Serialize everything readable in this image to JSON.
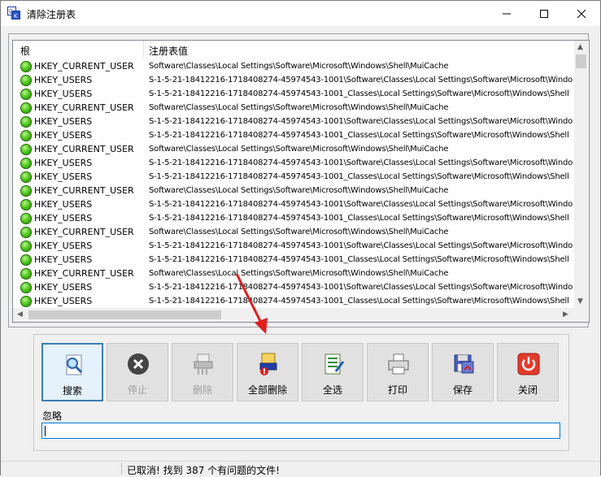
{
  "window": {
    "title": "清除注册表",
    "controls": {
      "minimize": "minimize-icon",
      "maximize": "maximize-icon",
      "close": "close-icon"
    }
  },
  "list": {
    "columns": [
      "根",
      "注册表值"
    ],
    "rows": [
      {
        "root": "HKEY_CURRENT_USER",
        "value": "Software\\Classes\\Local Settings\\Software\\Microsoft\\Windows\\Shell\\MuiCache"
      },
      {
        "root": "HKEY_USERS",
        "value": "S-1-5-21-18412216-1718408274-45974543-1001\\Software\\Classes\\Local Settings\\Software\\Microsoft\\Windo"
      },
      {
        "root": "HKEY_USERS",
        "value": "S-1-5-21-18412216-1718408274-45974543-1001_Classes\\Local Settings\\Software\\Microsoft\\Windows\\Shell"
      },
      {
        "root": "HKEY_CURRENT_USER",
        "value": "Software\\Classes\\Local Settings\\Software\\Microsoft\\Windows\\Shell\\MuiCache"
      },
      {
        "root": "HKEY_USERS",
        "value": "S-1-5-21-18412216-1718408274-45974543-1001\\Software\\Classes\\Local Settings\\Software\\Microsoft\\Windo"
      },
      {
        "root": "HKEY_USERS",
        "value": "S-1-5-21-18412216-1718408274-45974543-1001_Classes\\Local Settings\\Software\\Microsoft\\Windows\\Shell"
      },
      {
        "root": "HKEY_CURRENT_USER",
        "value": "Software\\Classes\\Local Settings\\Software\\Microsoft\\Windows\\Shell\\MuiCache"
      },
      {
        "root": "HKEY_USERS",
        "value": "S-1-5-21-18412216-1718408274-45974543-1001\\Software\\Classes\\Local Settings\\Software\\Microsoft\\Windo"
      },
      {
        "root": "HKEY_USERS",
        "value": "S-1-5-21-18412216-1718408274-45974543-1001_Classes\\Local Settings\\Software\\Microsoft\\Windows\\Shell"
      },
      {
        "root": "HKEY_CURRENT_USER",
        "value": "Software\\Classes\\Local Settings\\Software\\Microsoft\\Windows\\Shell\\MuiCache"
      },
      {
        "root": "HKEY_USERS",
        "value": "S-1-5-21-18412216-1718408274-45974543-1001\\Software\\Classes\\Local Settings\\Software\\Microsoft\\Windo"
      },
      {
        "root": "HKEY_USERS",
        "value": "S-1-5-21-18412216-1718408274-45974543-1001_Classes\\Local Settings\\Software\\Microsoft\\Windows\\Shell"
      },
      {
        "root": "HKEY_CURRENT_USER",
        "value": "Software\\Classes\\Local Settings\\Software\\Microsoft\\Windows\\Shell\\MuiCache"
      },
      {
        "root": "HKEY_USERS",
        "value": "S-1-5-21-18412216-1718408274-45974543-1001\\Software\\Classes\\Local Settings\\Software\\Microsoft\\Windo"
      },
      {
        "root": "HKEY_USERS",
        "value": "S-1-5-21-18412216-1718408274-45974543-1001_Classes\\Local Settings\\Software\\Microsoft\\Windows\\Shell"
      },
      {
        "root": "HKEY_CURRENT_USER",
        "value": "Software\\Classes\\Local Settings\\Software\\Microsoft\\Windows\\Shell\\MuiCache"
      },
      {
        "root": "HKEY_USERS",
        "value": "S-1-5-21-18412216-1718408274-45974543-1001\\Software\\Classes\\Local Settings\\Software\\Microsoft\\Windo"
      },
      {
        "root": "HKEY_USERS",
        "value": "S-1-5-21-18412216-1718408274-45974543-1001_Classes\\Local Settings\\Software\\Microsoft\\Windows\\Shell"
      }
    ]
  },
  "toolbar": {
    "buttons": [
      {
        "label": "搜索",
        "icon": "magnifier-icon",
        "state": "active"
      },
      {
        "label": "停止",
        "icon": "stop-icon",
        "state": "disabled"
      },
      {
        "label": "删除",
        "icon": "shredder-icon",
        "state": "disabled"
      },
      {
        "label": "全部删除",
        "icon": "delete-all-icon",
        "state": "normal"
      },
      {
        "label": "全选",
        "icon": "select-all-icon",
        "state": "normal"
      },
      {
        "label": "打印",
        "icon": "printer-icon",
        "state": "normal"
      },
      {
        "label": "保存",
        "icon": "floppy-disk-icon",
        "state": "normal"
      },
      {
        "label": "关闭",
        "icon": "power-icon",
        "state": "normal"
      }
    ]
  },
  "ignore": {
    "label": "忽略",
    "value": ""
  },
  "status": {
    "text": "已取消! 找到 387 个有问题的文件!"
  },
  "colors": {
    "accent": "#0078d7",
    "status_ok": "#3cb800",
    "arrow": "#e02020"
  }
}
